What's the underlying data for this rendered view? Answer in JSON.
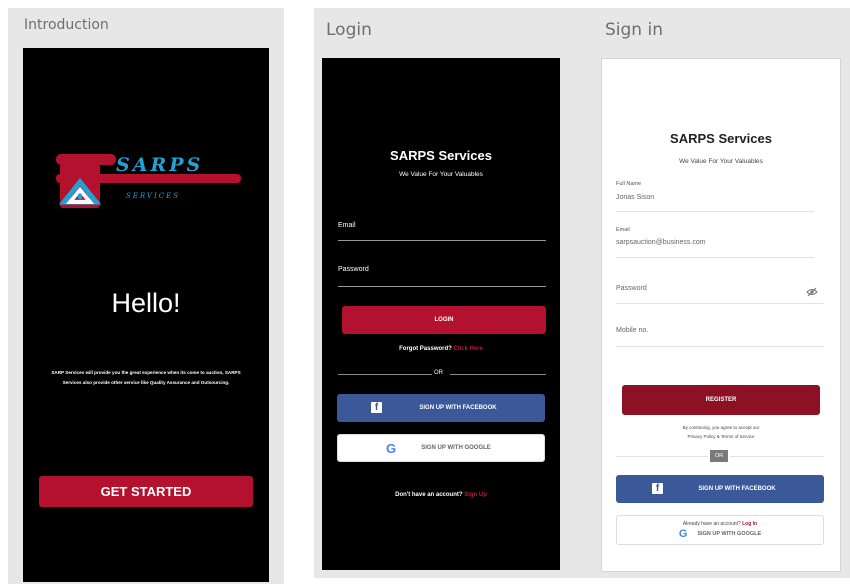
{
  "intro": {
    "panel_title": "Introduction",
    "logo_text": "SARPS",
    "logo_sub": "SERVICES",
    "heading": "Hello!",
    "body_text": "SARP Services will provide you the great experience when its come to auction, SARPS Services also provide other service like Quality Assurance and Outsourcing.",
    "cta": "GET STARTED"
  },
  "login": {
    "panel_title": "Login",
    "title": "SARPS Services",
    "tagline": "We Value For Your Valuables",
    "email_label": "Email",
    "password_label": "Password",
    "login_button": "LOGIN",
    "forgot_text": "Forgot Password?",
    "forgot_link": "Click Here",
    "or_text": "OR",
    "facebook_button": "SIGN UP WITH FACEBOOK",
    "google_button": "SIGN UP WITH GOOGLE",
    "no_account_text": "Don't have an account?",
    "signup_link": "Sign Up"
  },
  "signin": {
    "panel_title": "Sign in",
    "title": "SARPS Services",
    "tagline": "We Value For Your Valuables",
    "fullname_label": "Full Name",
    "fullname_value": "Jonas Sison",
    "email_label": "Email",
    "email_value": "sarpsauction@business.com",
    "password_label": "Password",
    "mobile_label": "Mobile no.",
    "register_button": "REGISTER",
    "terms_line1": "By continuing, you agree to accept our",
    "terms_line2": "Privacy Policy & Terms of Service",
    "or_text": "OR",
    "facebook_button": "SIGN UP WITH FACEBOOK",
    "have_account_text": "Already have an account?",
    "login_link": "Log In",
    "google_button": "SIGN UP WITH GOOGLE"
  },
  "colors": {
    "brand_red": "#b3112e",
    "register_red": "#8e1024",
    "facebook_blue": "#3b5998",
    "logo_blue": "#1fa3d6"
  }
}
